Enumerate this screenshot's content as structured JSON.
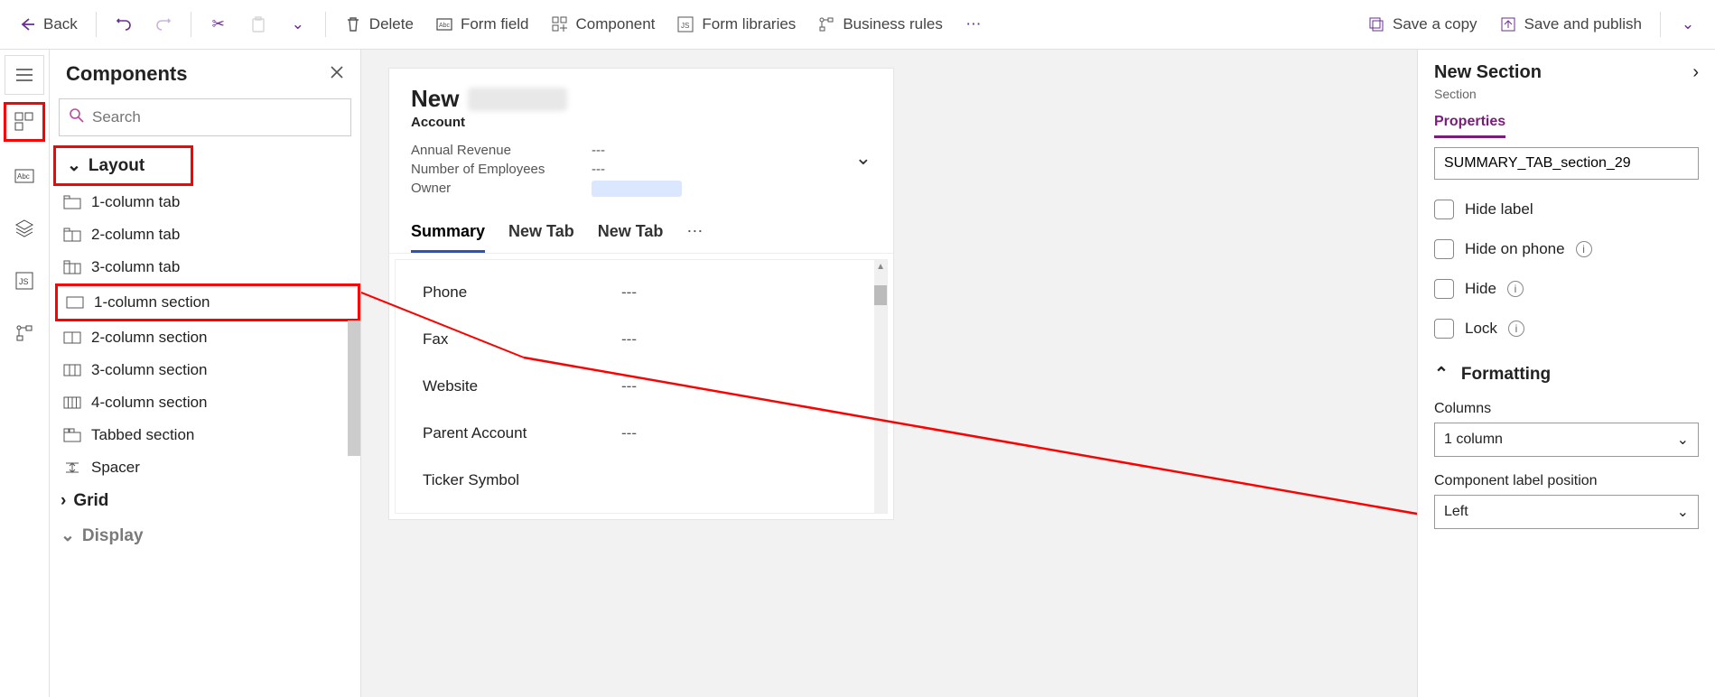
{
  "toolbar": {
    "back": "Back",
    "delete": "Delete",
    "form_field": "Form field",
    "component": "Component",
    "form_libraries": "Form libraries",
    "business_rules": "Business rules",
    "save_copy": "Save a copy",
    "save_publish": "Save and publish"
  },
  "components_panel": {
    "title": "Components",
    "search_placeholder": "Search",
    "groups": {
      "layout": "Layout",
      "grid": "Grid",
      "display": "Display"
    },
    "layout_items": [
      "1-column tab",
      "2-column tab",
      "3-column tab",
      "1-column section",
      "2-column section",
      "3-column section",
      "4-column section",
      "Tabbed section",
      "Spacer"
    ]
  },
  "canvas": {
    "title_prefix": "New",
    "entity": "Account",
    "meta": {
      "annual_revenue_label": "Annual Revenue",
      "annual_revenue_value": "---",
      "num_employees_label": "Number of Employees",
      "num_employees_value": "---",
      "owner_label": "Owner"
    },
    "tabs": [
      "Summary",
      "New Tab",
      "New Tab"
    ],
    "fields": [
      {
        "label": "Phone",
        "value": "---"
      },
      {
        "label": "Fax",
        "value": "---"
      },
      {
        "label": "Website",
        "value": "---"
      },
      {
        "label": "Parent Account",
        "value": "---"
      },
      {
        "label": "Ticker Symbol",
        "value": ""
      }
    ]
  },
  "props": {
    "title": "New Section",
    "crumb": "Section",
    "tab": "Properties",
    "name_value": "SUMMARY_TAB_section_29",
    "hide_label": "Hide label",
    "hide_phone": "Hide on phone",
    "hide": "Hide",
    "lock": "Lock",
    "formatting": "Formatting",
    "columns_label": "Columns",
    "columns_value": "1 column",
    "label_pos_label": "Component label position",
    "label_pos_value": "Left"
  }
}
